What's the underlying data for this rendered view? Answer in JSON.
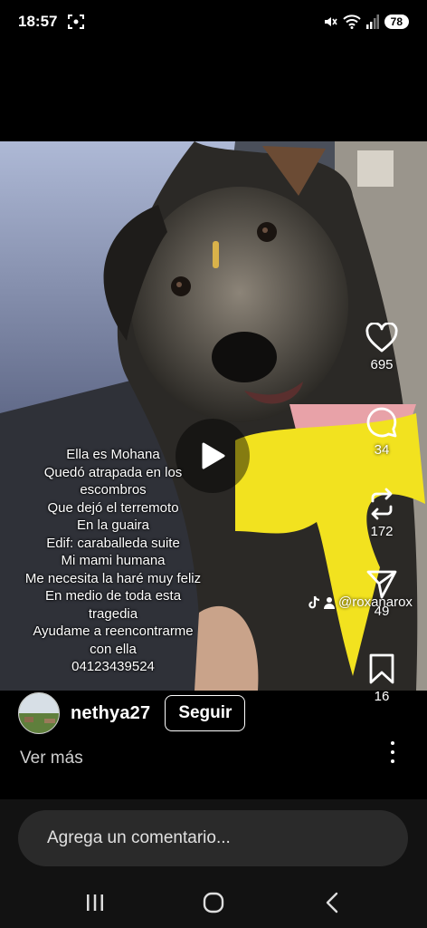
{
  "status_bar": {
    "time": "18:57",
    "battery": "78"
  },
  "post": {
    "caption_lines": [
      "Ella es Mohana",
      "Quedó atrapada en los",
      "escombros",
      "Que dejó el terremoto",
      "En la guaira",
      "Edif: caraballeda suite",
      "Mi mami humana",
      "Me necesita la haré muy feliz",
      "En medio de toda esta",
      "tragedia",
      "Ayudame a reencontrarme",
      "con ella",
      "04123439524"
    ],
    "watermark": "@roxanarox",
    "actions": {
      "likes": "695",
      "comments": "34",
      "reposts": "172",
      "shares": "49",
      "saves": "16"
    },
    "author": {
      "username": "nethya27",
      "follow_label": "Seguir"
    },
    "see_more": "Ver más"
  },
  "comment": {
    "placeholder": "Agrega un comentario..."
  },
  "icons": {
    "like": "heart-icon",
    "comment": "comment-bubble-icon",
    "repost": "repost-icon",
    "share": "paper-plane-icon",
    "save": "bookmark-icon",
    "play": "play-icon",
    "more": "more-vertical-icon"
  }
}
